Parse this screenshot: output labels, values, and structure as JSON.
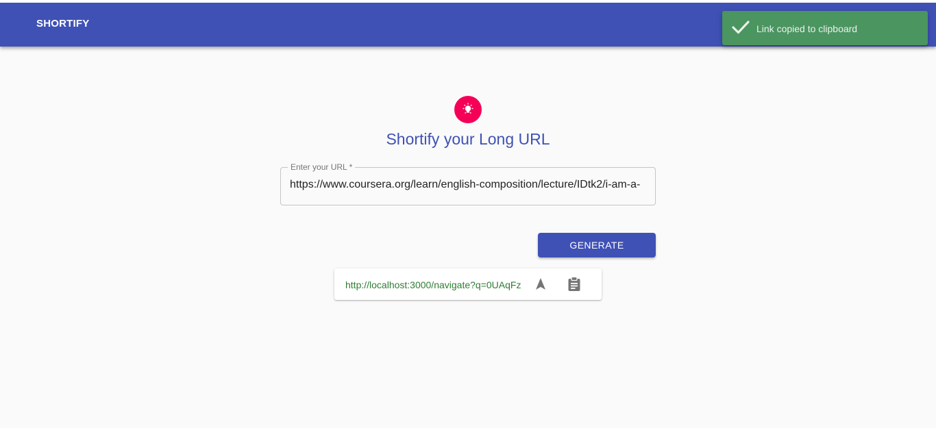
{
  "appbar": {
    "brand": "SHORTIFY",
    "color": "#3f51b5"
  },
  "toast": {
    "icon": "check-icon",
    "message": "Link copied to clipboard",
    "color": "#4b9560"
  },
  "main": {
    "logo_icon": "lightbulb-icon",
    "logo_color": "#f50057",
    "title": "Shortify your Long URL",
    "url_field": {
      "label": "Enter your URL *",
      "value": "https://www.coursera.org/learn/english-composition/lecture/IDtk2/i-am-a-"
    },
    "generate_label": "GENERATE",
    "result": {
      "short_url": "http://localhost:3000/navigate?q=0UAqFz",
      "link_color": "#2e7d32",
      "navigate_icon": "navigation-arrow-icon",
      "copy_icon": "clipboard-icon"
    }
  }
}
